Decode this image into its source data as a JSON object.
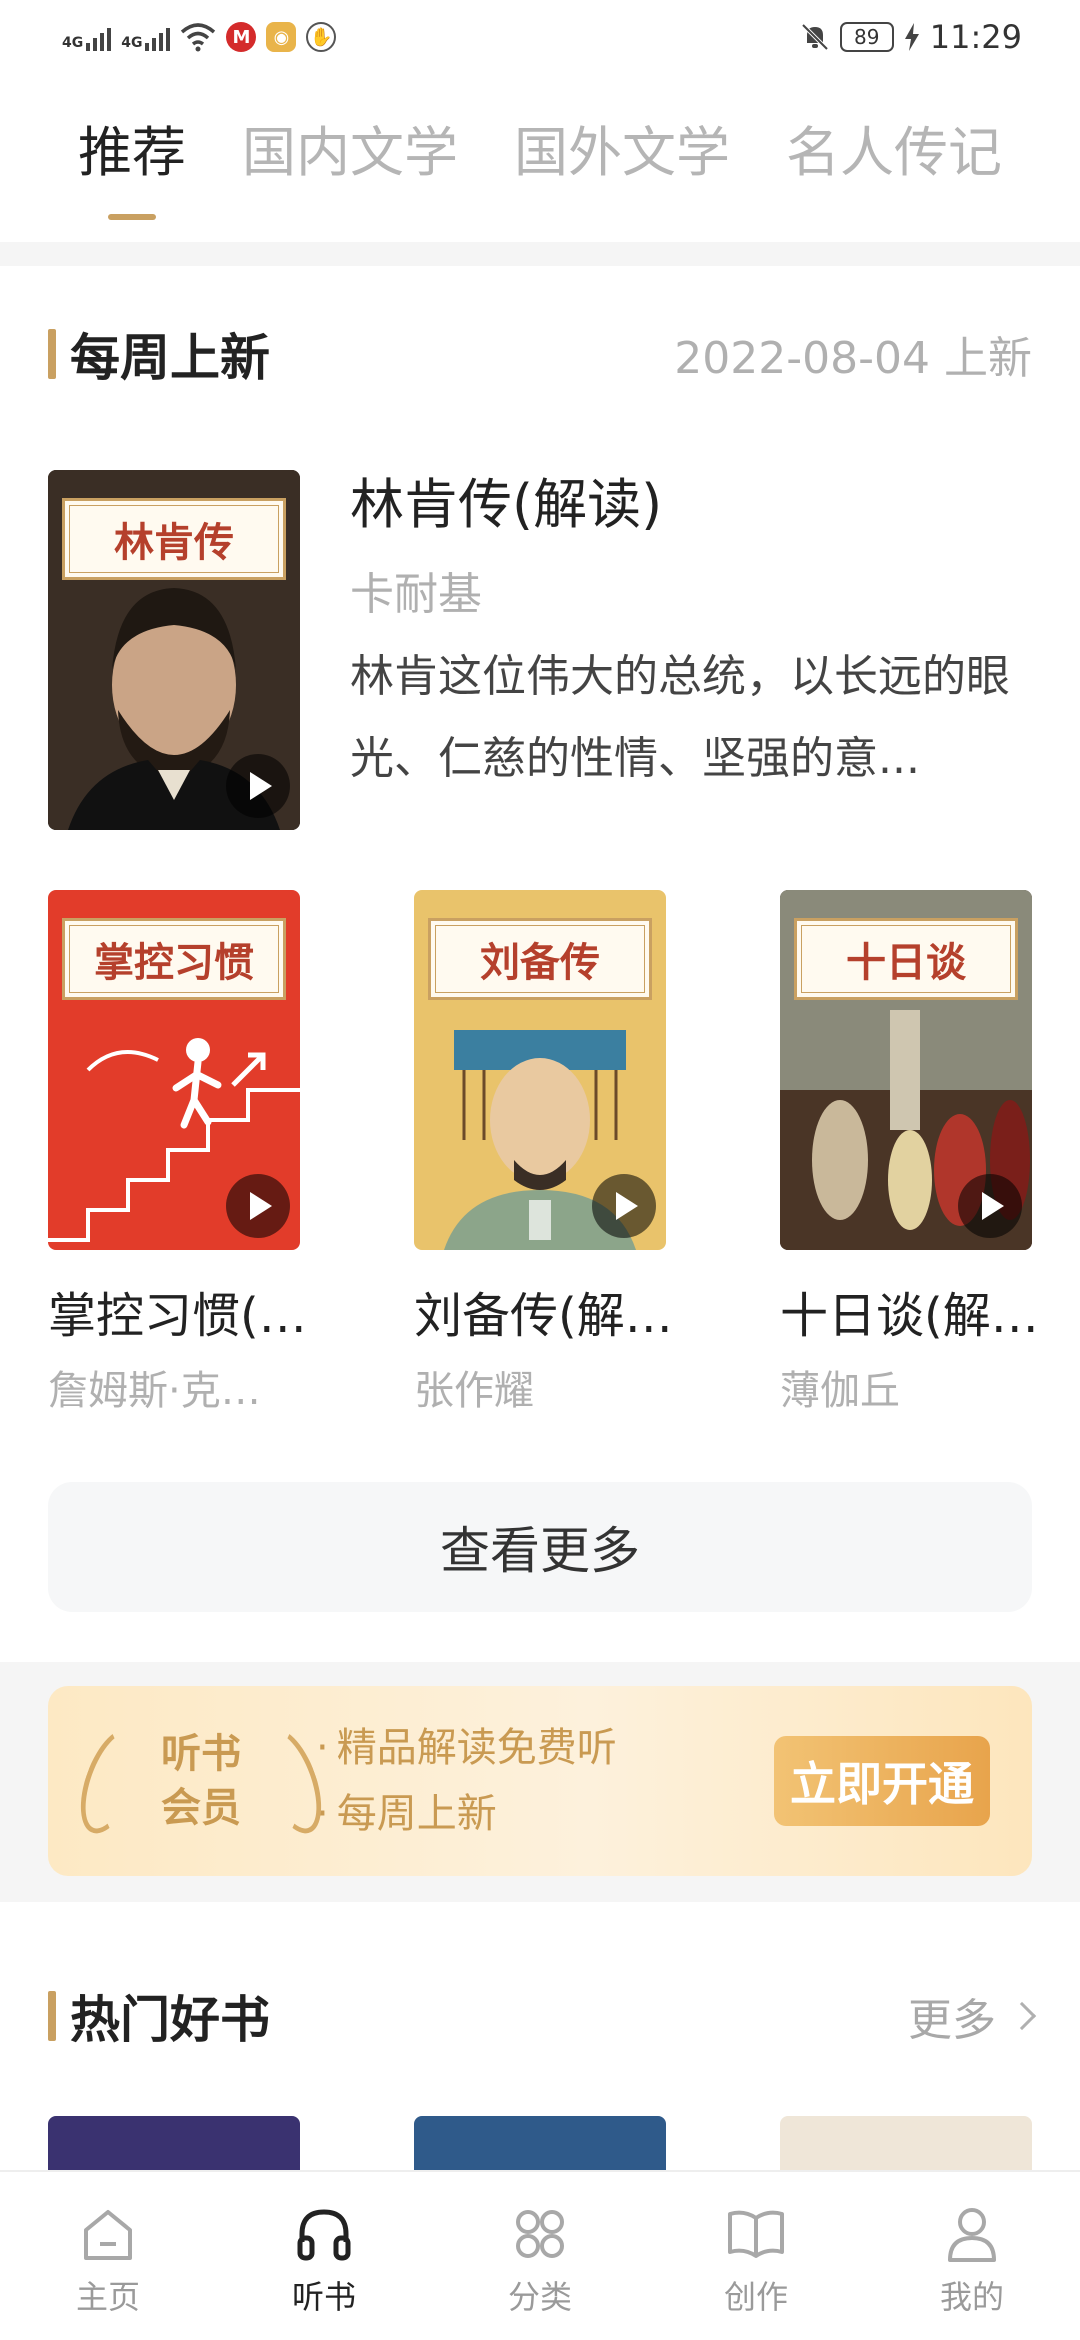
{
  "status_bar": {
    "net1": "4G",
    "net2": "4G",
    "battery": "89",
    "time": "11:29"
  },
  "tabs": [
    "推荐",
    "国内文学",
    "国外文学",
    "名人传记"
  ],
  "weekly": {
    "title": "每周上新",
    "date": "2022-08-04 上新",
    "featured": {
      "cover_title": "林肯传",
      "title": "林肯传(解读)",
      "author": "卡耐基",
      "desc": "林肯这位伟大的总统，以长远的眼光、仁慈的性情、坚强的意..."
    },
    "books": [
      {
        "cover_title": "掌控习惯",
        "title": "掌控习惯(解读)",
        "author": "詹姆斯·克利尔",
        "cover_color": "#e23c2a"
      },
      {
        "cover_title": "刘备传",
        "title": "刘备传(解读)",
        "author": "张作耀",
        "cover_color": "#e9c36b"
      },
      {
        "cover_title": "十日谈",
        "title": "十日谈(解读)",
        "author": "薄伽丘",
        "cover_color": "#5a4236"
      }
    ],
    "more_button": "查看更多"
  },
  "vip": {
    "line1": "听书",
    "line2": "会员",
    "points": [
      "精品解读免费听",
      "每周上新"
    ],
    "button": "立即开通"
  },
  "hot": {
    "title": "热门好书",
    "more": "更多"
  },
  "nav": [
    {
      "label": "主页",
      "icon": "home-icon"
    },
    {
      "label": "听书",
      "icon": "headphones-icon"
    },
    {
      "label": "分类",
      "icon": "grid-icon"
    },
    {
      "label": "创作",
      "icon": "open-book-icon"
    },
    {
      "label": "我的",
      "icon": "person-icon"
    }
  ],
  "colors": {
    "accent": "#c9a061",
    "vip_text": "#c99a52",
    "vip_button": "#e8a44c"
  }
}
